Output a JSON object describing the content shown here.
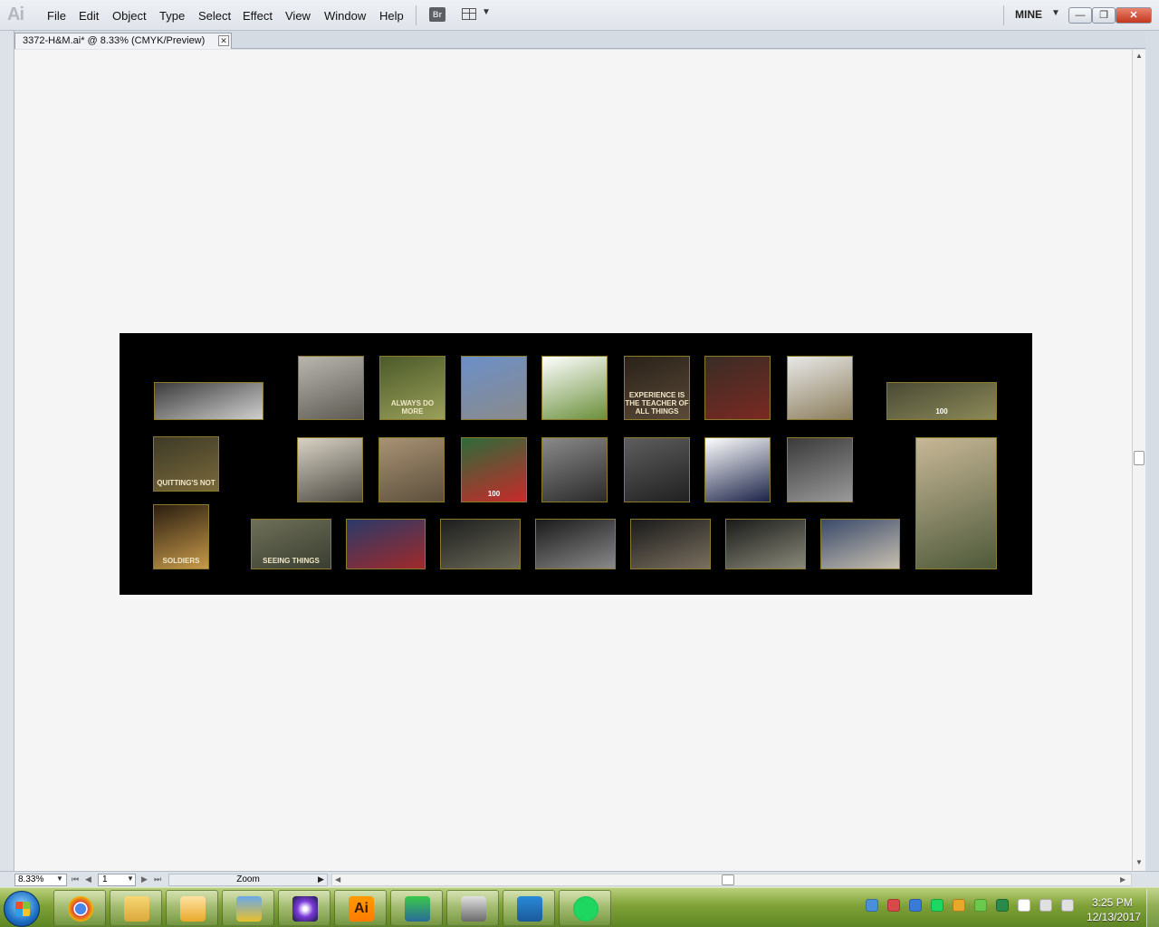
{
  "app": {
    "logo": "Ai"
  },
  "menu": [
    "File",
    "Edit",
    "Object",
    "Type",
    "Select",
    "Effect",
    "View",
    "Window",
    "Help"
  ],
  "toolbar": {
    "bridge_label": "Br",
    "workspace": "MINE"
  },
  "window_controls": {
    "minimize": "—",
    "restore": "❐",
    "close": "✕"
  },
  "document": {
    "tab_title": "3372-H&M.ai* @ 8.33% (CMYK/Preview)",
    "close_glyph": "✕"
  },
  "artboard": {
    "thumbnails": [
      {
        "caption": "",
        "palette": [
          "#3c3c3c",
          "#cfcfcf"
        ]
      },
      {
        "caption": "",
        "palette": [
          "#b9b6af",
          "#5d5a52"
        ]
      },
      {
        "caption": "ALWAYS DO MORE",
        "palette": [
          "#4c5a2a",
          "#9aa05a"
        ]
      },
      {
        "caption": "",
        "palette": [
          "#6b8fc8",
          "#8a8a8a"
        ]
      },
      {
        "caption": "",
        "palette": [
          "#ffffff",
          "#6a8f3a"
        ]
      },
      {
        "caption": "EXPERIENCE IS THE TEACHER OF ALL THINGS",
        "palette": [
          "#2a2219",
          "#5a4a38"
        ]
      },
      {
        "caption": "",
        "palette": [
          "#3a2c26",
          "#7a2a22"
        ]
      },
      {
        "caption": "",
        "palette": [
          "#e8e8e8",
          "#8a7c5a"
        ]
      },
      {
        "caption": "100",
        "palette": [
          "#4a4a36",
          "#8c8a58"
        ]
      },
      {
        "caption": "QUITTING'S NOT",
        "palette": [
          "#3d3a28",
          "#7a6a3a"
        ]
      },
      {
        "caption": "",
        "palette": [
          "#d8d2c4",
          "#4d4a42"
        ]
      },
      {
        "caption": "",
        "palette": [
          "#a89274",
          "#5c4f3c"
        ]
      },
      {
        "caption": "100",
        "palette": [
          "#2d6b3a",
          "#c82a2a"
        ]
      },
      {
        "caption": "",
        "palette": [
          "#8a8a8a",
          "#2a2a2a"
        ]
      },
      {
        "caption": "",
        "palette": [
          "#5e5e5e",
          "#202020"
        ]
      },
      {
        "caption": "",
        "palette": [
          "#ffffff",
          "#1b2348"
        ]
      },
      {
        "caption": "",
        "palette": [
          "#3a3a3a",
          "#9a9a9a"
        ]
      },
      {
        "caption": "",
        "palette": [
          "#c7b796",
          "#4e5a3a"
        ]
      },
      {
        "caption": "SOLDIERS",
        "palette": [
          "#2a1e10",
          "#c89a4a"
        ]
      },
      {
        "caption": "SEEING THINGS",
        "palette": [
          "#6e7058",
          "#3a3e30"
        ]
      },
      {
        "caption": "",
        "palette": [
          "#2a3a6a",
          "#a02a2a"
        ]
      },
      {
        "caption": "",
        "palette": [
          "#1e1e1e",
          "#6a6a5a"
        ]
      },
      {
        "caption": "",
        "palette": [
          "#1a1a1a",
          "#8a8a8a"
        ]
      },
      {
        "caption": "",
        "palette": [
          "#1a1a1a",
          "#7a7060"
        ]
      },
      {
        "caption": "",
        "palette": [
          "#1a1a1a",
          "#8a8a7a"
        ]
      },
      {
        "caption": "",
        "palette": [
          "#3a4a6a",
          "#c8c0b0"
        ]
      }
    ]
  },
  "status": {
    "zoom": "8.33%",
    "artboard_number": "1",
    "label": "Zoom"
  },
  "taskbar": {
    "apps": [
      "chrome",
      "file-explorer",
      "outlook",
      "virtualbox",
      "photo-app",
      "illustrator",
      "network-app",
      "dev-app",
      "security-app",
      "spotify"
    ],
    "illustrator_label": "Ai",
    "clock_time": "3:25 PM",
    "clock_date": "12/13/2017"
  }
}
